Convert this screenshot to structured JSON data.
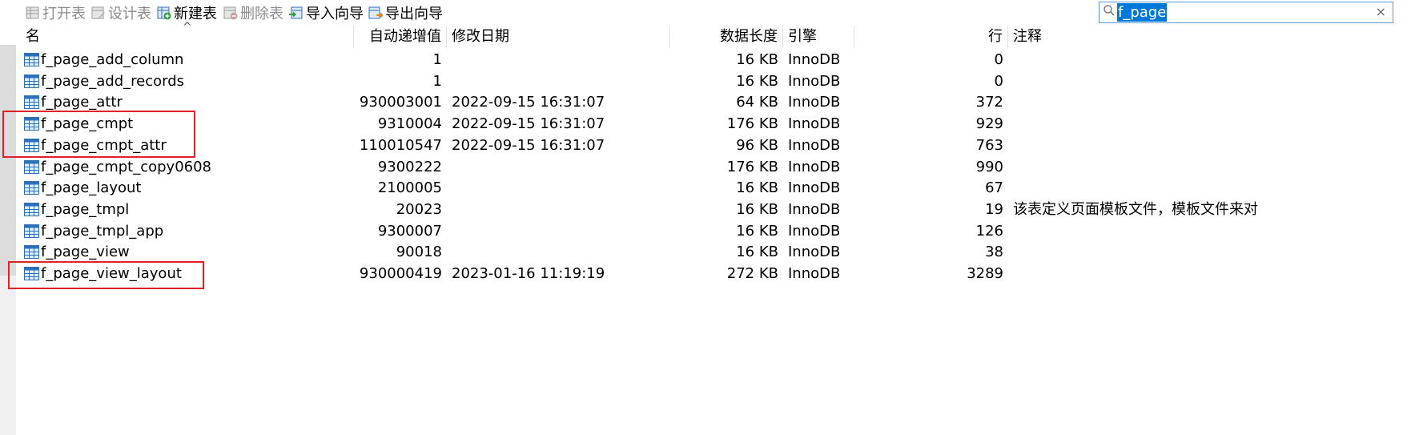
{
  "toolbar": {
    "open_table": "打开表",
    "design_table": "设计表",
    "new_table": "新建表",
    "delete_table": "删除表",
    "import_wizard": "导入向导",
    "export_wizard": "导出向导"
  },
  "search": {
    "value": "f_page",
    "clear_glyph": "×"
  },
  "table": {
    "columns": {
      "name": "名",
      "auto_increment": "自动递增值",
      "modified": "修改日期",
      "data_length": "数据长度",
      "engine": "引擎",
      "rows": "行",
      "comment": "注释"
    },
    "sort_glyph": "^",
    "rows": [
      {
        "name": "f_page_add_column",
        "auto_inc": "1",
        "modified": "",
        "data_length": "16 KB",
        "engine": "InnoDB",
        "rows": "0",
        "comment": ""
      },
      {
        "name": "f_page_add_records",
        "auto_inc": "1",
        "modified": "",
        "data_length": "16 KB",
        "engine": "InnoDB",
        "rows": "0",
        "comment": ""
      },
      {
        "name": "f_page_attr",
        "auto_inc": "930003001",
        "modified": "2022-09-15 16:31:07",
        "data_length": "64 KB",
        "engine": "InnoDB",
        "rows": "372",
        "comment": ""
      },
      {
        "name": "f_page_cmpt",
        "auto_inc": "9310004",
        "modified": "2022-09-15 16:31:07",
        "data_length": "176 KB",
        "engine": "InnoDB",
        "rows": "929",
        "comment": ""
      },
      {
        "name": "f_page_cmpt_attr",
        "auto_inc": "110010547",
        "modified": "2022-09-15 16:31:07",
        "data_length": "96 KB",
        "engine": "InnoDB",
        "rows": "763",
        "comment": ""
      },
      {
        "name": "f_page_cmpt_copy0608",
        "auto_inc": "9300222",
        "modified": "",
        "data_length": "176 KB",
        "engine": "InnoDB",
        "rows": "990",
        "comment": ""
      },
      {
        "name": "f_page_layout",
        "auto_inc": "2100005",
        "modified": "",
        "data_length": "16 KB",
        "engine": "InnoDB",
        "rows": "67",
        "comment": ""
      },
      {
        "name": "f_page_tmpl",
        "auto_inc": "20023",
        "modified": "",
        "data_length": "16 KB",
        "engine": "InnoDB",
        "rows": "19",
        "comment": "该表定义页面模板文件，模板文件来对"
      },
      {
        "name": "f_page_tmpl_app",
        "auto_inc": "9300007",
        "modified": "",
        "data_length": "16 KB",
        "engine": "InnoDB",
        "rows": "126",
        "comment": ""
      },
      {
        "name": "f_page_view",
        "auto_inc": "90018",
        "modified": "",
        "data_length": "16 KB",
        "engine": "InnoDB",
        "rows": "38",
        "comment": ""
      },
      {
        "name": "f_page_view_layout",
        "auto_inc": "930000419",
        "modified": "2023-01-16 11:19:19",
        "data_length": "272 KB",
        "engine": "InnoDB",
        "rows": "3289",
        "comment": ""
      }
    ]
  },
  "colors": {
    "highlight_box": "#e0212b",
    "selection": "#0078d7",
    "table_icon": "#2f6fb7"
  }
}
